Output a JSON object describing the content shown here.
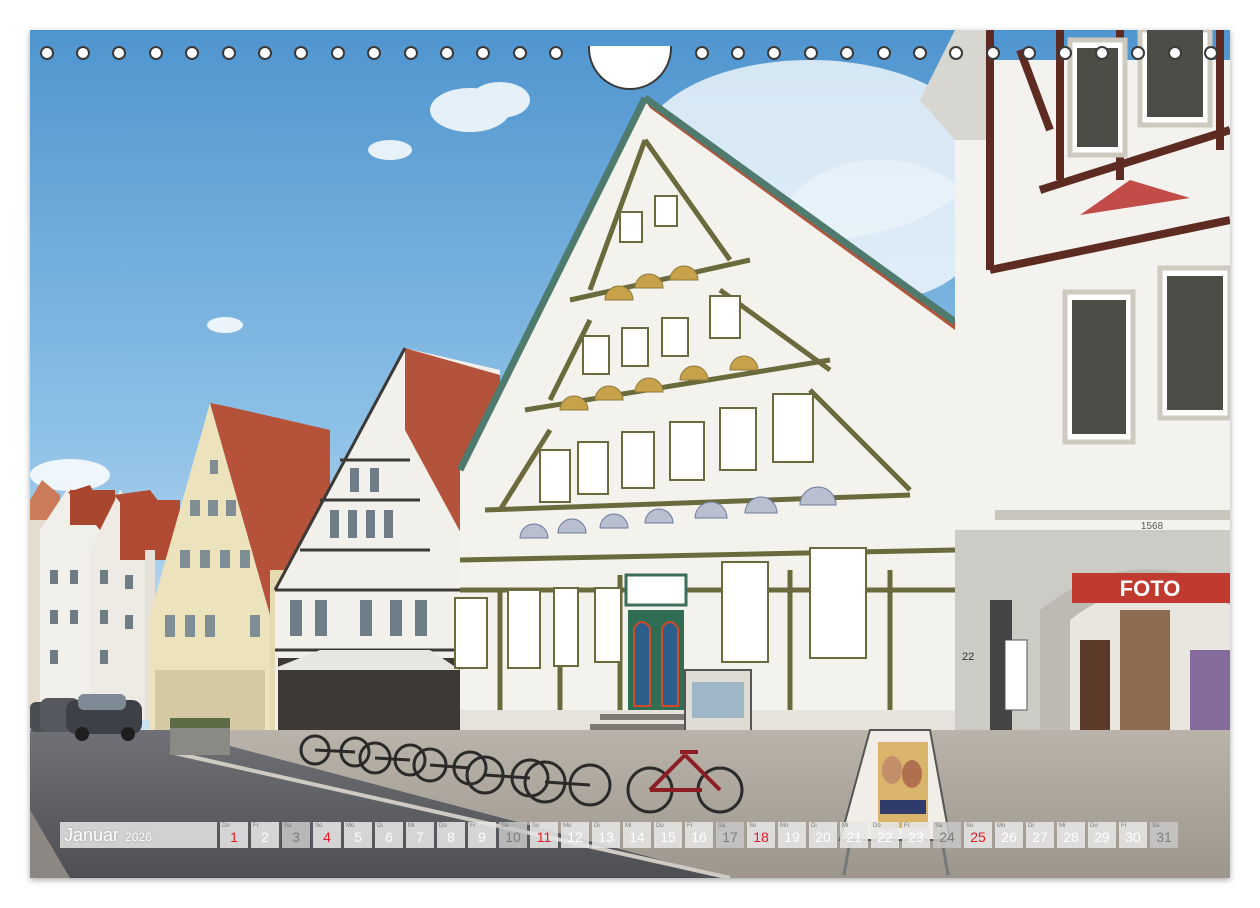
{
  "calendar": {
    "month": "Januar",
    "year": "2026",
    "days": [
      {
        "n": "1",
        "wd": "Do",
        "t": "hol"
      },
      {
        "n": "2",
        "wd": "Fr",
        "t": "wk"
      },
      {
        "n": "3",
        "wd": "Sa",
        "t": "sat"
      },
      {
        "n": "4",
        "wd": "So",
        "t": "sun"
      },
      {
        "n": "5",
        "wd": "Mo",
        "t": "wk"
      },
      {
        "n": "6",
        "wd": "Di",
        "t": "wk"
      },
      {
        "n": "7",
        "wd": "Mi",
        "t": "wk"
      },
      {
        "n": "8",
        "wd": "Do",
        "t": "wk"
      },
      {
        "n": "9",
        "wd": "Fr",
        "t": "wk"
      },
      {
        "n": "10",
        "wd": "Sa",
        "t": "sat"
      },
      {
        "n": "11",
        "wd": "So",
        "t": "sun"
      },
      {
        "n": "12",
        "wd": "Mo",
        "t": "wk"
      },
      {
        "n": "13",
        "wd": "Di",
        "t": "wk"
      },
      {
        "n": "14",
        "wd": "Mi",
        "t": "wk"
      },
      {
        "n": "15",
        "wd": "Do",
        "t": "wk"
      },
      {
        "n": "16",
        "wd": "Fr",
        "t": "wk"
      },
      {
        "n": "17",
        "wd": "Sa",
        "t": "sat"
      },
      {
        "n": "18",
        "wd": "So",
        "t": "sun"
      },
      {
        "n": "19",
        "wd": "Mo",
        "t": "wk"
      },
      {
        "n": "20",
        "wd": "Di",
        "t": "wk"
      },
      {
        "n": "21",
        "wd": "Mi",
        "t": "wk"
      },
      {
        "n": "22",
        "wd": "Do",
        "t": "wk"
      },
      {
        "n": "23",
        "wd": "Fr",
        "t": "wk"
      },
      {
        "n": "24",
        "wd": "Sa",
        "t": "sat"
      },
      {
        "n": "25",
        "wd": "So",
        "t": "sun"
      },
      {
        "n": "26",
        "wd": "Mo",
        "t": "wk"
      },
      {
        "n": "27",
        "wd": "Di",
        "t": "wk"
      },
      {
        "n": "28",
        "wd": "Mi",
        "t": "wk"
      },
      {
        "n": "29",
        "wd": "Do",
        "t": "wk"
      },
      {
        "n": "30",
        "wd": "Fr",
        "t": "wk"
      },
      {
        "n": "31",
        "wd": "Sa",
        "t": "sat"
      }
    ]
  },
  "signs": {
    "shop_sign": "FOTO",
    "house_number": "22",
    "year_plaque": "1568"
  },
  "colors": {
    "sky": "#6fa9d6",
    "timber": "#6b6a3c",
    "roof": "#b4533b",
    "sunday": "#e31b24"
  }
}
